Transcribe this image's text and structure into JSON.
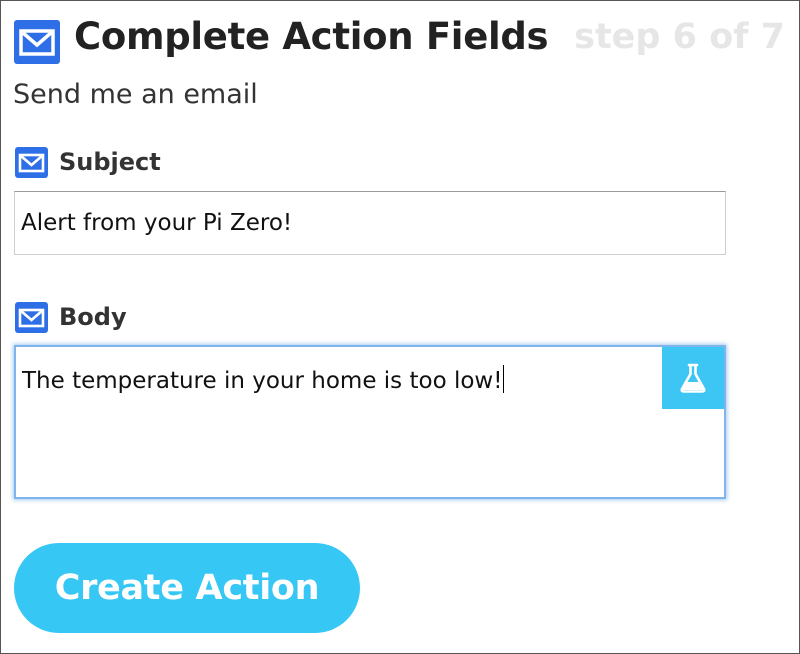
{
  "header": {
    "title": "Complete Action Fields",
    "step": "step 6 of 7",
    "icon": "envelope-icon"
  },
  "action": {
    "subtitle": "Send me an email"
  },
  "fields": {
    "subject": {
      "label": "Subject",
      "icon": "envelope-icon",
      "value": "Alert from your Pi Zero!"
    },
    "body": {
      "label": "Body",
      "icon": "envelope-icon",
      "value": "The temperature in your home is too low!",
      "ingredient_button_icon": "flask-icon"
    }
  },
  "buttons": {
    "create_action": "Create Action"
  },
  "colors": {
    "icon_blue": "#2e6fe8",
    "accent_cyan": "#36c7f5",
    "step_gray": "#e6e6e6",
    "focus_blue": "#7fb5ec"
  }
}
